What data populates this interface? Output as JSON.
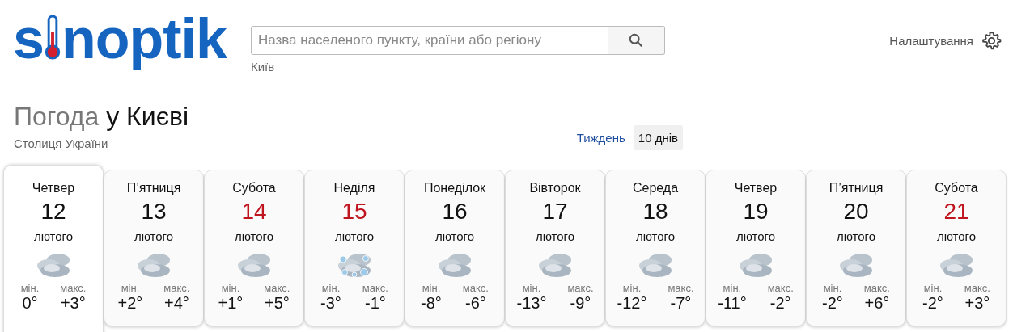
{
  "logo": {
    "before": "s",
    "after": "noptik"
  },
  "search": {
    "placeholder": "Назва населеного пункту, країни або регіону",
    "hint": "Київ"
  },
  "settings": {
    "label": "Налаштування"
  },
  "heading": {
    "prefix": "Погода",
    "place": "у Києві",
    "subtitle": "Столиця України"
  },
  "tabs": [
    {
      "label": "Тиждень",
      "selected": false
    },
    {
      "label": "10 днів",
      "selected": true
    }
  ],
  "days": [
    {
      "weekday": "Четвер",
      "date": "12",
      "month": "лютого",
      "weekend": false,
      "selected": true,
      "kind": "cloudy",
      "min_label": "мін.",
      "min": "0°",
      "max_label": "макс.",
      "max": "+3°"
    },
    {
      "weekday": "П’ятниця",
      "date": "13",
      "month": "лютого",
      "weekend": false,
      "selected": false,
      "kind": "cloudy",
      "min_label": "мін.",
      "min": "+2°",
      "max_label": "макс.",
      "max": "+4°"
    },
    {
      "weekday": "Субота",
      "date": "14",
      "month": "лютого",
      "weekend": true,
      "selected": false,
      "kind": "cloudy",
      "min_label": "мін.",
      "min": "+1°",
      "max_label": "макс.",
      "max": "+5°"
    },
    {
      "weekday": "Неділя",
      "date": "15",
      "month": "лютого",
      "weekend": true,
      "selected": false,
      "kind": "snow",
      "min_label": "мін.",
      "min": "-3°",
      "max_label": "макс.",
      "max": "-1°"
    },
    {
      "weekday": "Понеділок",
      "date": "16",
      "month": "лютого",
      "weekend": false,
      "selected": false,
      "kind": "cloudy",
      "min_label": "мін.",
      "min": "-8°",
      "max_label": "макс.",
      "max": "-6°"
    },
    {
      "weekday": "Вівторок",
      "date": "17",
      "month": "лютого",
      "weekend": false,
      "selected": false,
      "kind": "cloudy",
      "min_label": "мін.",
      "min": "-13°",
      "max_label": "макс.",
      "max": "-9°"
    },
    {
      "weekday": "Середа",
      "date": "18",
      "month": "лютого",
      "weekend": false,
      "selected": false,
      "kind": "cloudy",
      "min_label": "мін.",
      "min": "-12°",
      "max_label": "макс.",
      "max": "-7°"
    },
    {
      "weekday": "Четвер",
      "date": "19",
      "month": "лютого",
      "weekend": false,
      "selected": false,
      "kind": "cloudy",
      "min_label": "мін.",
      "min": "-11°",
      "max_label": "макс.",
      "max": "-2°"
    },
    {
      "weekday": "П’ятниця",
      "date": "20",
      "month": "лютого",
      "weekend": false,
      "selected": false,
      "kind": "cloudy",
      "min_label": "мін.",
      "min": "-2°",
      "max_label": "макс.",
      "max": "+6°"
    },
    {
      "weekday": "Субота",
      "date": "21",
      "month": "лютого",
      "weekend": true,
      "selected": false,
      "kind": "cloudy",
      "min_label": "мін.",
      "min": "-2°",
      "max_label": "макс.",
      "max": "+3°"
    }
  ]
}
